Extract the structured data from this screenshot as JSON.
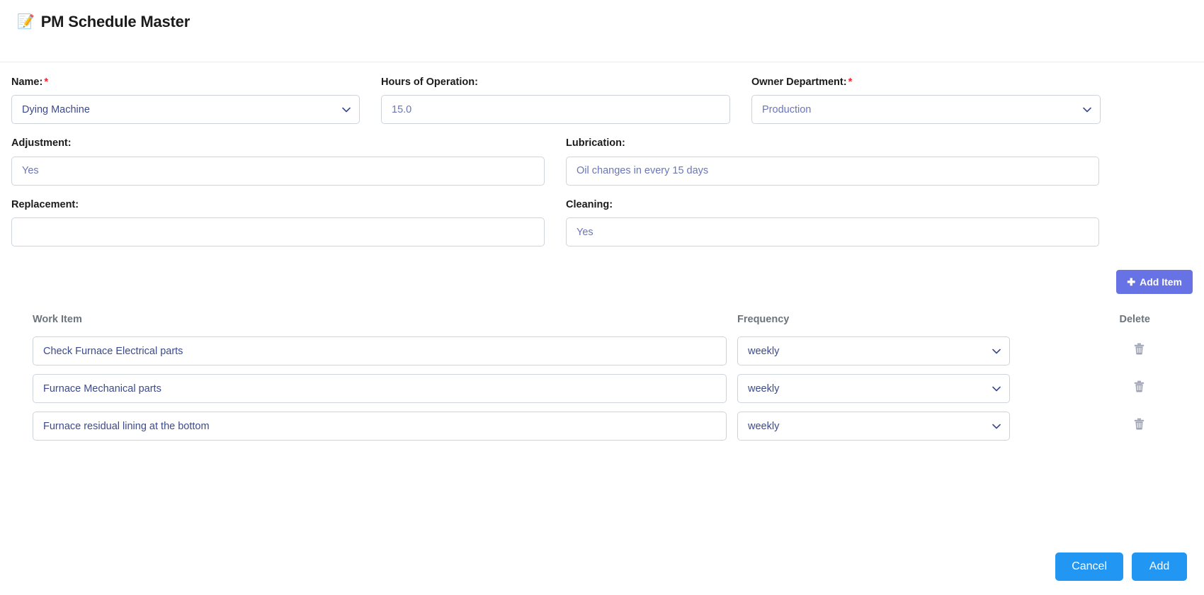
{
  "header": {
    "icon": "memo-icon",
    "title": "PM Schedule Master"
  },
  "colors": {
    "add_item_bg": "#6772e5",
    "action_button_bg": "#2196f3",
    "required_asterisk": "#f5222d",
    "field_text": "#3c4a8a",
    "table_header_text": "#6c757d",
    "border": "#ced4da"
  },
  "form": {
    "name": {
      "label": "Name:",
      "required": "*",
      "value": "Dying Machine",
      "type": "select"
    },
    "hours_of_operation": {
      "label": "Hours of Operation:",
      "value": "15.0",
      "type": "text"
    },
    "owner_department": {
      "label": "Owner Department:",
      "required": "*",
      "value": "Production",
      "type": "select"
    },
    "adjustment": {
      "label": "Adjustment:",
      "value": "Yes",
      "type": "text"
    },
    "lubrication": {
      "label": "Lubrication:",
      "value": "Oil changes in every 15 days",
      "type": "text"
    },
    "replacement": {
      "label": "Replacement:",
      "value": "",
      "type": "text"
    },
    "cleaning": {
      "label": "Cleaning:",
      "value": "Yes",
      "type": "text"
    }
  },
  "toolbar": {
    "add_item_label": "Add Item",
    "add_item_icon": "plus-icon"
  },
  "items_table": {
    "headers": {
      "work_item": "Work Item",
      "frequency": "Frequency",
      "delete": "Delete"
    },
    "rows": [
      {
        "work_item": "Check Furnace Electrical parts",
        "frequency": "weekly",
        "delete_icon": "trash-icon"
      },
      {
        "work_item": "Furnace Mechanical parts",
        "frequency": "weekly",
        "delete_icon": "trash-icon"
      },
      {
        "work_item": "Furnace residual lining at the bottom",
        "frequency": "weekly",
        "delete_icon": "trash-icon"
      }
    ]
  },
  "footer": {
    "cancel_label": "Cancel",
    "add_label": "Add"
  }
}
